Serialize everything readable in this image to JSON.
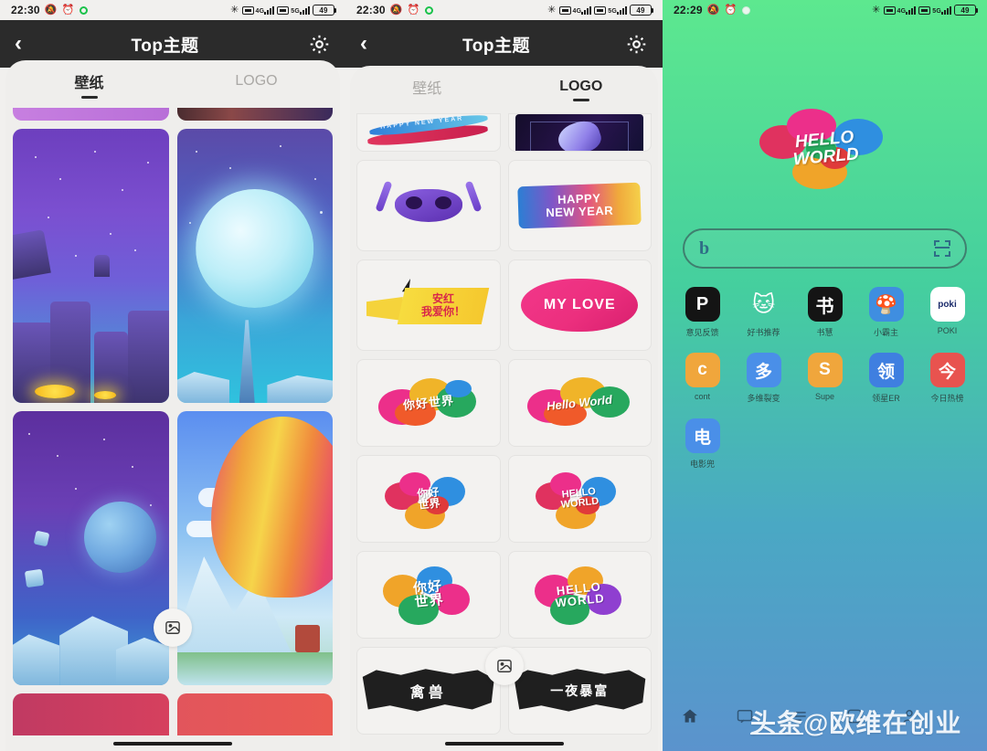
{
  "panels": [
    {
      "id": "theme-wallpaper",
      "statusbar": {
        "time": "22:30",
        "icons": [
          "silent-icon",
          "alarm-icon",
          "record-dot-icon",
          "bluetooth-icon",
          "sim1-icon",
          "sim2-icon"
        ],
        "net1": "4G",
        "net2": "5G",
        "battery": "49"
      },
      "appbar": {
        "back": "‹",
        "title": "Top主题",
        "settings": "gear-icon"
      },
      "tabs": [
        {
          "label": "壁纸",
          "active": true
        },
        {
          "label": "LOGO",
          "active": false
        }
      ],
      "fab": "image-picker-icon"
    },
    {
      "id": "theme-logo",
      "statusbar": {
        "time": "22:30",
        "icons": [
          "silent-icon",
          "alarm-icon",
          "record-dot-icon",
          "bluetooth-icon",
          "sim1-icon",
          "sim2-icon"
        ],
        "net1": "4G",
        "net2": "5G",
        "battery": "49"
      },
      "appbar": {
        "back": "‹",
        "title": "Top主题",
        "settings": "gear-icon"
      },
      "tabs": [
        {
          "label": "壁纸",
          "active": false
        },
        {
          "label": "LOGO",
          "active": true
        }
      ],
      "fab": "image-picker-icon",
      "logos": {
        "row0": [
          {
            "text": "HAPPY NEW YEAR",
            "kind": "swoosh"
          },
          {
            "text": "",
            "kind": "dark-orchid"
          }
        ],
        "row1": [
          {
            "text": "",
            "kind": "monster"
          },
          {
            "text": "HAPPY\nNEW YEAR",
            "kind": "watercolor"
          }
        ],
        "row2": [
          {
            "text": "安红\n我爱你！",
            "kind": "megaphone"
          },
          {
            "text": "MY LOVE",
            "kind": "blob"
          }
        ],
        "row3": [
          {
            "text": "你好世界",
            "kind": "splatter-wide"
          },
          {
            "text": "Hello World",
            "kind": "splatter-wide"
          }
        ],
        "row4": [
          {
            "text": "你好\n世界",
            "kind": "balloon-splat"
          },
          {
            "text": "HELLO\nWORLD",
            "kind": "balloon-splat"
          }
        ],
        "row5": [
          {
            "text": "你好\n世界",
            "kind": "splatter-bold"
          },
          {
            "text": "HELLO\nWORLD",
            "kind": "splatter-bold"
          }
        ],
        "row6": [
          {
            "text": "禽兽",
            "kind": "brush"
          },
          {
            "text": "一夜暴富",
            "kind": "brush"
          }
        ]
      }
    },
    {
      "id": "home-screen",
      "statusbar": {
        "time": "22:29",
        "icons": [
          "silent-icon",
          "alarm-icon",
          "record-dot-icon",
          "bluetooth-icon",
          "sim1-icon",
          "sim2-icon"
        ],
        "net1": "4G",
        "net2": "5G",
        "battery": "49"
      },
      "logo_text": "HELLO\nWORLD",
      "search": {
        "left_icon": "bing-icon",
        "right_icon": "scan-icon",
        "placeholder": ""
      },
      "apps": [
        {
          "label": "意见反馈",
          "glyph": "P",
          "bg": "#141414",
          "fg": "#ffffff"
        },
        {
          "label": "好书推荐",
          "glyph": "🐱",
          "bg": "#b9c4f0",
          "fg": "#6f7fd8"
        },
        {
          "label": "书慧",
          "glyph": "书",
          "bg": "#141414",
          "fg": "#ffffff"
        },
        {
          "label": "小霸主",
          "glyph": "🍄",
          "bg": "#3f8ee0",
          "fg": "#ffffff"
        },
        {
          "label": "POKI",
          "glyph": "poki",
          "bg": "#ffffff",
          "fg": "#1b2b6b"
        },
        {
          "label": "cont",
          "glyph": "c",
          "bg": "#f0a63c",
          "fg": "#ffffff"
        },
        {
          "label": "多维裂变",
          "glyph": "多",
          "bg": "#4a8fe8",
          "fg": "#ffffff"
        },
        {
          "label": "Supe",
          "glyph": "S",
          "bg": "#f0a63c",
          "fg": "#ffffff"
        },
        {
          "label": "领星ER",
          "glyph": "领",
          "bg": "#3f7fe0",
          "fg": "#ffffff"
        },
        {
          "label": "今日热榜",
          "glyph": "今",
          "bg": "#e8534f",
          "fg": "#ffffff"
        },
        {
          "label": "电影兜",
          "glyph": "电",
          "bg": "#4a8fe8",
          "fg": "#ffffff"
        }
      ],
      "dock": [
        "home-icon",
        "message-icon",
        "menu-icon",
        "app-icon",
        "person-icon"
      ],
      "watermark": {
        "prefix": "头条",
        "handle": "@欧维在创业"
      }
    }
  ],
  "colors": {
    "appbar_bg": "#2b2b2b",
    "sheet_bg": "#efeeec",
    "home_top": "#5de88f",
    "home_bottom": "#5b93cd",
    "tab_active": "#2a2a2a",
    "tab_inactive": "#aaa8a5"
  }
}
